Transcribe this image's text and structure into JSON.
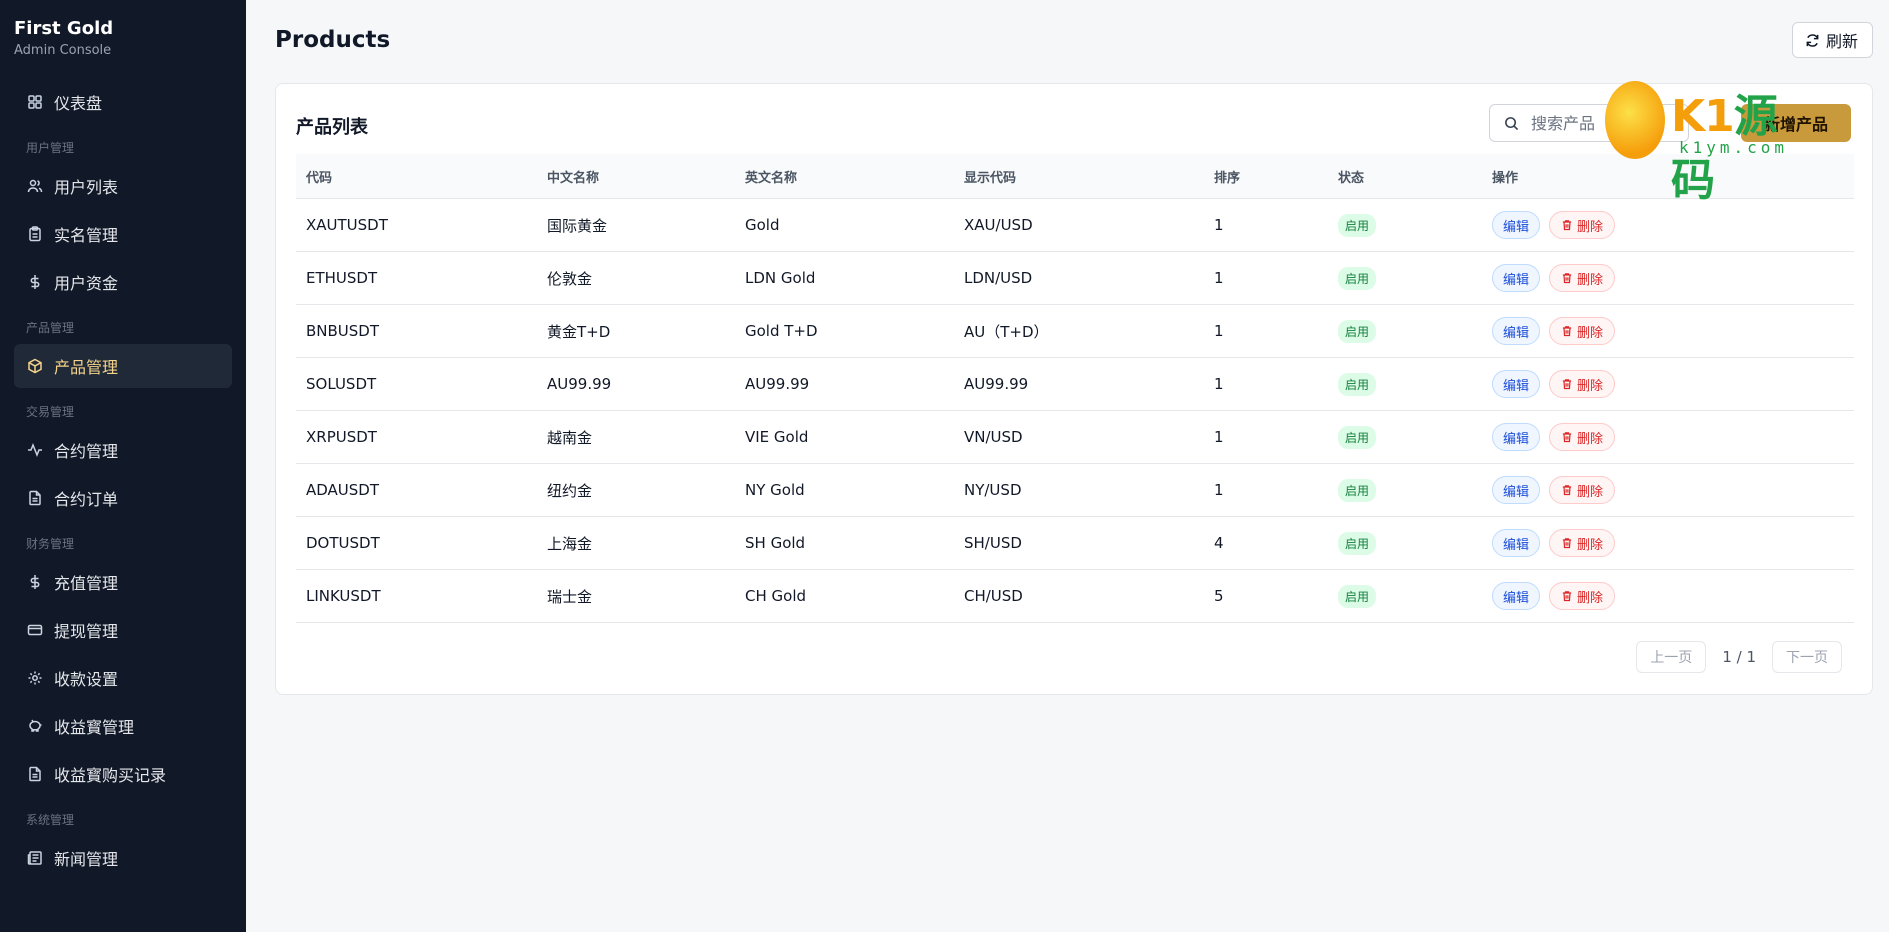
{
  "brand": {
    "name": "First Gold",
    "subtitle": "Admin Console"
  },
  "sidebar": {
    "dashboard": {
      "label": "仪表盘",
      "icon": "grid-icon"
    },
    "sections": [
      {
        "title": "用户管理",
        "items": [
          {
            "label": "用户列表",
            "icon": "users-icon"
          },
          {
            "label": "实名管理",
            "icon": "clipboard-icon"
          },
          {
            "label": "用户资金",
            "icon": "dollar-icon"
          }
        ]
      },
      {
        "title": "产品管理",
        "items": [
          {
            "label": "产品管理",
            "icon": "box-icon",
            "active": true
          }
        ]
      },
      {
        "title": "交易管理",
        "items": [
          {
            "label": "合约管理",
            "icon": "activity-icon"
          },
          {
            "label": "合约订单",
            "icon": "file-icon"
          }
        ]
      },
      {
        "title": "财务管理",
        "items": [
          {
            "label": "充值管理",
            "icon": "dollar-icon"
          },
          {
            "label": "提现管理",
            "icon": "card-icon"
          },
          {
            "label": "收款设置",
            "icon": "gear-icon"
          },
          {
            "label": "收益寳管理",
            "icon": "piggy-bank-icon"
          },
          {
            "label": "收益寳购买记录",
            "icon": "file-icon"
          }
        ]
      },
      {
        "title": "系统管理",
        "items": [
          {
            "label": "新闻管理",
            "icon": "newspaper-icon"
          }
        ]
      }
    ]
  },
  "header": {
    "title": "Products",
    "refresh_label": "刷新"
  },
  "card": {
    "title": "产品列表",
    "search_placeholder": "搜索产品",
    "add_label": "新增产品"
  },
  "table": {
    "headers": [
      "代码",
      "中文名称",
      "英文名称",
      "显示代码",
      "排序",
      "状态",
      "操作"
    ],
    "rows": [
      {
        "code": "XAUTUSDT",
        "cn": "国际黄金",
        "en": "Gold",
        "display": "XAU/USD",
        "sort": "1",
        "status": "启用"
      },
      {
        "code": "ETHUSDT",
        "cn": "伦敦金",
        "en": "LDN Gold",
        "display": "LDN/USD",
        "sort": "1",
        "status": "启用"
      },
      {
        "code": "BNBUSDT",
        "cn": "黄金T+D",
        "en": "Gold T+D",
        "display": "AU（T+D）",
        "sort": "1",
        "status": "启用"
      },
      {
        "code": "SOLUSDT",
        "cn": "AU99.99",
        "en": "AU99.99",
        "display": "AU99.99",
        "sort": "1",
        "status": "启用"
      },
      {
        "code": "XRPUSDT",
        "cn": "越南金",
        "en": "VIE Gold",
        "display": "VN/USD",
        "sort": "1",
        "status": "启用"
      },
      {
        "code": "ADAUSDT",
        "cn": "纽约金",
        "en": "NY Gold",
        "display": "NY/USD",
        "sort": "1",
        "status": "启用"
      },
      {
        "code": "DOTUSDT",
        "cn": "上海金",
        "en": "SH Gold",
        "display": "SH/USD",
        "sort": "4",
        "status": "启用"
      },
      {
        "code": "LINKUSDT",
        "cn": "瑞士金",
        "en": "CH Gold",
        "display": "CH/USD",
        "sort": "5",
        "status": "启用"
      }
    ],
    "edit_label": "编辑",
    "delete_label": "删除"
  },
  "pagination": {
    "prev": "上一页",
    "info": "1 / 1",
    "next": "下一页"
  },
  "watermark": {
    "letters_a": "K1",
    "letters_b": "源码",
    "domain": "k1ym.com"
  },
  "colors": {
    "sidebar_bg": "#111827",
    "accent": "#c99a3c",
    "active_text": "#f5d38a",
    "status_green": "#15803d"
  }
}
